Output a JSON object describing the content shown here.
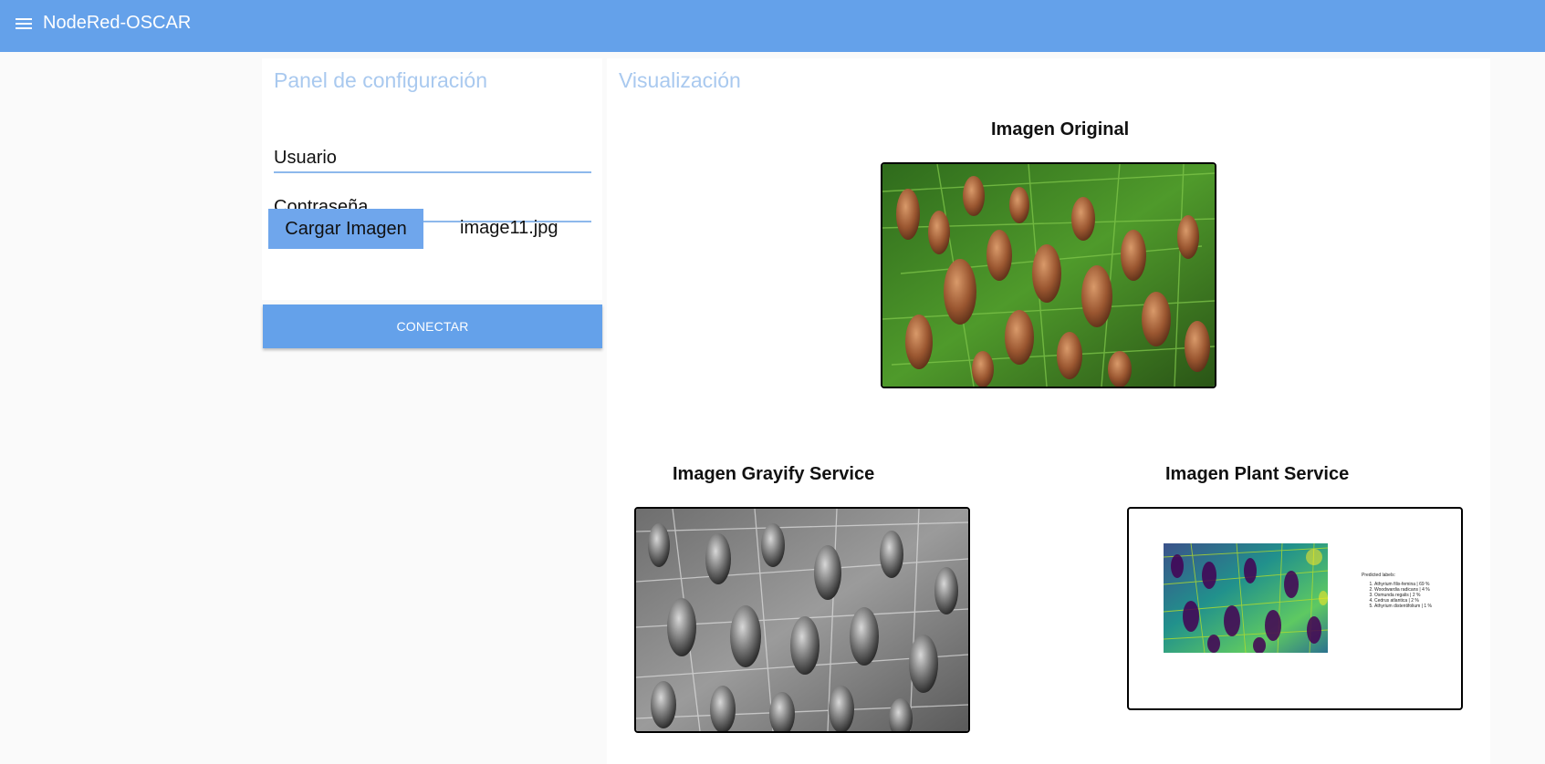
{
  "app": {
    "title": "NodeRed-OSCAR"
  },
  "config_panel": {
    "title": "Panel de configuración",
    "user_label": "Usuario",
    "password_label": "Contraseña",
    "upload_button": "Cargar Imagen",
    "file_name": "image11.jpg",
    "connect_button": "CONECTAR"
  },
  "viz_panel": {
    "title": "Visualización",
    "original_caption": "Imagen Original",
    "grayify_caption": "Imagen Grayify Service",
    "plant_caption": "Imagen Plant Service",
    "plant_result": {
      "heading": "Predicted labels:",
      "labels": [
        "Athyrium filix-femina | 69 %",
        "Woodwardia radicans | 4 %",
        "Osmunda regalis | 2 %",
        "Cedrus atlantica | 2 %",
        "Athyrium distentifolium | 1 %"
      ]
    }
  },
  "colors": {
    "accent": "#64a1ea",
    "panel_title": "#a9c9ef"
  }
}
